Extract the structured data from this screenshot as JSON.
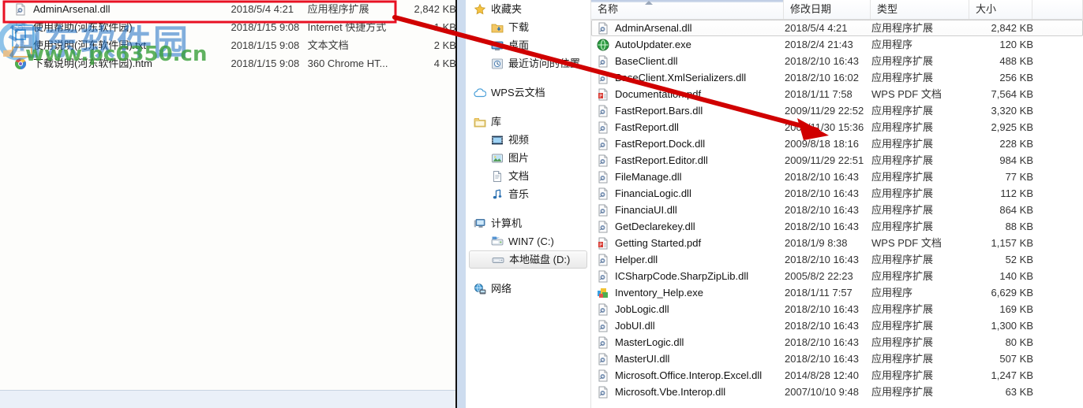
{
  "left_pane": {
    "name": "background-explorer-pane",
    "rows": [
      {
        "icon": "dll-icon",
        "name": "AdminArsenal.dll",
        "date": "2018/5/4 4:21",
        "type": "应用程序扩展",
        "size": "2,842 KB",
        "selected": true
      },
      {
        "icon": "internet-shortcut-icon",
        "name": "使用帮助(河东软件园)",
        "date": "2018/1/15 9:08",
        "type": "Internet 快捷方式",
        "size": "1 KB",
        "selected": false
      },
      {
        "icon": "text-file-icon",
        "name": "使用说明(河东软件园).txt",
        "date": "2018/1/15 9:08",
        "type": "文本文档",
        "size": "2 KB",
        "selected": false
      },
      {
        "icon": "chrome-html-icon",
        "name": "下载说明(河东软件园).htm",
        "date": "2018/1/15 9:08",
        "type": "360 Chrome HT...",
        "size": "4 KB",
        "selected": false
      }
    ]
  },
  "watermark": {
    "text_cn": "河东软件园",
    "text_url": "www.pc6350.cn",
    "color_cn": "#1d6fc4",
    "color_url": "#3aa03a"
  },
  "annotations": {
    "highlight_box": {
      "label": "red-highlight-rectangle",
      "color": "#e81123"
    },
    "arrow": {
      "label": "red-pointer-arrow",
      "color": "#d00000"
    }
  },
  "nav_tree": {
    "items": [
      {
        "label": "收藏夹",
        "icon": "star-icon",
        "depth": 0,
        "selected": false,
        "gap_before": false
      },
      {
        "label": "下载",
        "icon": "downloads-folder-icon",
        "depth": 1,
        "selected": false,
        "gap_before": false
      },
      {
        "label": "桌面",
        "icon": "desktop-icon",
        "depth": 1,
        "selected": false,
        "gap_before": false
      },
      {
        "label": "最近访问的位置",
        "icon": "recent-places-icon",
        "depth": 1,
        "selected": false,
        "gap_before": false
      },
      {
        "label": "WPS云文档",
        "icon": "cloud-icon",
        "depth": 0,
        "selected": false,
        "gap_before": true
      },
      {
        "label": "库",
        "icon": "library-folder-icon",
        "depth": 0,
        "selected": false,
        "gap_before": true
      },
      {
        "label": "视频",
        "icon": "video-icon",
        "depth": 1,
        "selected": false,
        "gap_before": false
      },
      {
        "label": "图片",
        "icon": "pictures-icon",
        "depth": 1,
        "selected": false,
        "gap_before": false
      },
      {
        "label": "文档",
        "icon": "documents-icon",
        "depth": 1,
        "selected": false,
        "gap_before": false
      },
      {
        "label": "音乐",
        "icon": "music-note-icon",
        "depth": 1,
        "selected": false,
        "gap_before": false
      },
      {
        "label": "计算机",
        "icon": "computer-icon",
        "depth": 0,
        "selected": false,
        "gap_before": true
      },
      {
        "label": "WIN7 (C:)",
        "icon": "system-drive-icon",
        "depth": 1,
        "selected": false,
        "gap_before": false
      },
      {
        "label": "本地磁盘 (D:)",
        "icon": "hard-drive-icon",
        "depth": 1,
        "selected": true,
        "gap_before": false
      },
      {
        "label": "网络",
        "icon": "network-icon",
        "depth": 0,
        "selected": false,
        "gap_before": true
      }
    ]
  },
  "file_list": {
    "columns": [
      {
        "key": "name",
        "label": "名称",
        "sorted": true
      },
      {
        "key": "date",
        "label": "修改日期",
        "sorted": false
      },
      {
        "key": "type",
        "label": "类型",
        "sorted": false
      },
      {
        "key": "size",
        "label": "大小",
        "sorted": false
      }
    ],
    "rows": [
      {
        "icon": "dll-icon",
        "name": "AdminArsenal.dll",
        "date": "2018/5/4 4:21",
        "type": "应用程序扩展",
        "size": "2,842 KB",
        "selected": true
      },
      {
        "icon": "exe-globe-icon",
        "name": "AutoUpdater.exe",
        "date": "2018/2/4 21:43",
        "type": "应用程序",
        "size": "120 KB",
        "selected": false
      },
      {
        "icon": "dll-icon",
        "name": "BaseClient.dll",
        "date": "2018/2/10 16:43",
        "type": "应用程序扩展",
        "size": "488 KB",
        "selected": false
      },
      {
        "icon": "dll-icon",
        "name": "BaseClient.XmlSerializers.dll",
        "date": "2018/2/10 16:02",
        "type": "应用程序扩展",
        "size": "256 KB",
        "selected": false
      },
      {
        "icon": "pdf-icon",
        "name": "Documentation.pdf",
        "date": "2018/1/11 7:58",
        "type": "WPS PDF 文档",
        "size": "7,564 KB",
        "selected": false
      },
      {
        "icon": "dll-icon",
        "name": "FastReport.Bars.dll",
        "date": "2009/11/29 22:52",
        "type": "应用程序扩展",
        "size": "3,320 KB",
        "selected": false
      },
      {
        "icon": "dll-icon",
        "name": "FastReport.dll",
        "date": "2009/11/30 15:36",
        "type": "应用程序扩展",
        "size": "2,925 KB",
        "selected": false
      },
      {
        "icon": "dll-icon",
        "name": "FastReport.Dock.dll",
        "date": "2009/8/18 18:16",
        "type": "应用程序扩展",
        "size": "228 KB",
        "selected": false
      },
      {
        "icon": "dll-icon",
        "name": "FastReport.Editor.dll",
        "date": "2009/11/29 22:51",
        "type": "应用程序扩展",
        "size": "984 KB",
        "selected": false
      },
      {
        "icon": "dll-icon",
        "name": "FileManage.dll",
        "date": "2018/2/10 16:43",
        "type": "应用程序扩展",
        "size": "77 KB",
        "selected": false
      },
      {
        "icon": "dll-icon",
        "name": "FinanciaLogic.dll",
        "date": "2018/2/10 16:43",
        "type": "应用程序扩展",
        "size": "112 KB",
        "selected": false
      },
      {
        "icon": "dll-icon",
        "name": "FinanciaUI.dll",
        "date": "2018/2/10 16:43",
        "type": "应用程序扩展",
        "size": "864 KB",
        "selected": false
      },
      {
        "icon": "dll-icon",
        "name": "GetDeclarekey.dll",
        "date": "2018/2/10 16:43",
        "type": "应用程序扩展",
        "size": "88 KB",
        "selected": false
      },
      {
        "icon": "pdf-icon",
        "name": "Getting Started.pdf",
        "date": "2018/1/9 8:38",
        "type": "WPS PDF 文档",
        "size": "1,157 KB",
        "selected": false
      },
      {
        "icon": "dll-icon",
        "name": "Helper.dll",
        "date": "2018/2/10 16:43",
        "type": "应用程序扩展",
        "size": "52 KB",
        "selected": false
      },
      {
        "icon": "dll-icon",
        "name": "ICSharpCode.SharpZipLib.dll",
        "date": "2005/8/2 22:23",
        "type": "应用程序扩展",
        "size": "140 KB",
        "selected": false
      },
      {
        "icon": "app-colorful-icon",
        "name": "Inventory_Help.exe",
        "date": "2018/1/11 7:57",
        "type": "应用程序",
        "size": "6,629 KB",
        "selected": false
      },
      {
        "icon": "dll-icon",
        "name": "JobLogic.dll",
        "date": "2018/2/10 16:43",
        "type": "应用程序扩展",
        "size": "169 KB",
        "selected": false
      },
      {
        "icon": "dll-icon",
        "name": "JobUI.dll",
        "date": "2018/2/10 16:43",
        "type": "应用程序扩展",
        "size": "1,300 KB",
        "selected": false
      },
      {
        "icon": "dll-icon",
        "name": "MasterLogic.dll",
        "date": "2018/2/10 16:43",
        "type": "应用程序扩展",
        "size": "80 KB",
        "selected": false
      },
      {
        "icon": "dll-icon",
        "name": "MasterUI.dll",
        "date": "2018/2/10 16:43",
        "type": "应用程序扩展",
        "size": "507 KB",
        "selected": false
      },
      {
        "icon": "dll-icon",
        "name": "Microsoft.Office.Interop.Excel.dll",
        "date": "2014/8/28 12:40",
        "type": "应用程序扩展",
        "size": "1,247 KB",
        "selected": false
      },
      {
        "icon": "dll-icon",
        "name": "Microsoft.Vbe.Interop.dll",
        "date": "2007/10/10 9:48",
        "type": "应用程序扩展",
        "size": "63 KB",
        "selected": false
      }
    ]
  }
}
